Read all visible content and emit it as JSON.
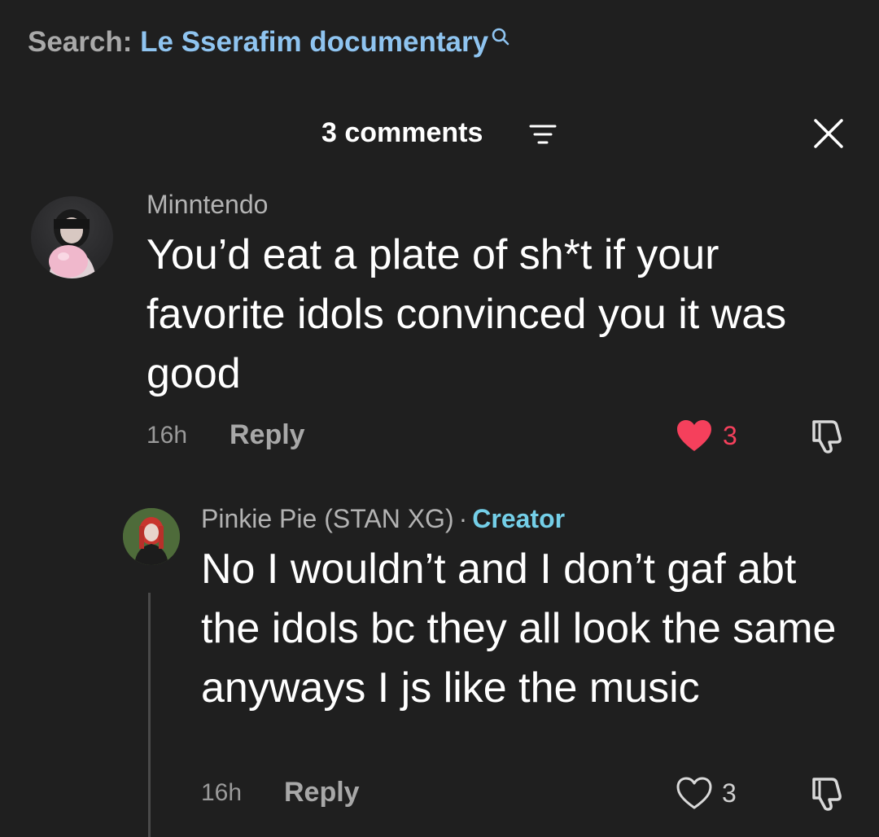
{
  "search": {
    "prefix": "Search:",
    "query": "Le Sserafim documentary",
    "icon": "search-icon"
  },
  "header": {
    "comment_count_label": "3 comments",
    "sort_icon": "sort-icon",
    "close_icon": "close-icon"
  },
  "comments": [
    {
      "username": "Minntendo",
      "text": "You’d eat a plate of sh*t if your favorite idols convinced you it was good",
      "timestamp": "16h",
      "reply_label": "Reply",
      "likes": "3",
      "liked": true,
      "like_color": "#f5405c"
    },
    {
      "username": "Pinkie Pie (STAN XG)",
      "separator": "·",
      "badge": "Creator",
      "text": "No I wouldn’t and I don’t gaf abt the idols bc they all look the same anyways I js like the music",
      "timestamp": "16h",
      "reply_label": "Reply",
      "likes": "3",
      "liked": false
    }
  ],
  "colors": {
    "background": "#1f1f1f",
    "creator_badge": "#74cfe8",
    "search_query": "#8fc4f0"
  }
}
